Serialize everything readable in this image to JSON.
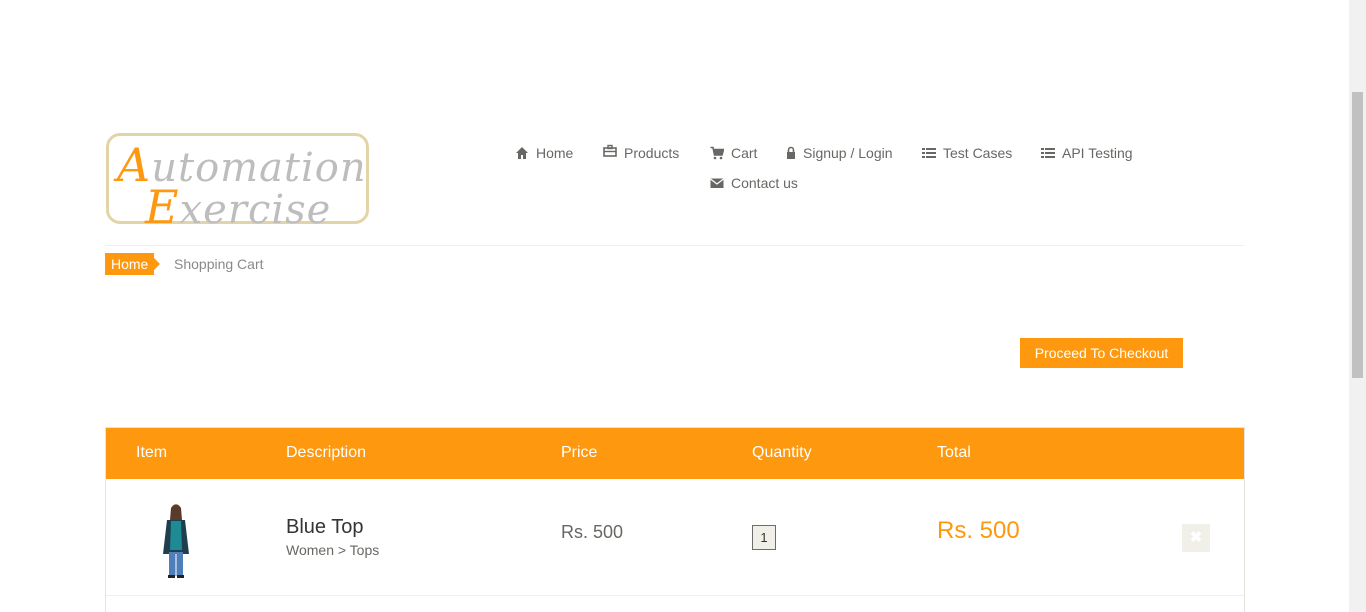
{
  "logo": {
    "line1_cap": "A",
    "line1_rest": "utomation",
    "line2_cap": "E",
    "line2_rest": "xercise"
  },
  "nav": {
    "home": "Home",
    "products": "Products",
    "cart": "Cart",
    "signup": "Signup / Login",
    "test_cases": "Test Cases",
    "api_testing": "API Testing",
    "contact": "Contact us"
  },
  "breadcrumb": {
    "home": "Home",
    "current": "Shopping Cart"
  },
  "checkout": {
    "label": "Proceed To Checkout"
  },
  "cart": {
    "headers": {
      "item": "Item",
      "description": "Description",
      "price": "Price",
      "quantity": "Quantity",
      "total": "Total"
    },
    "rows": [
      {
        "name": "Blue Top",
        "category": "Women > Tops",
        "price": "Rs. 500",
        "quantity": "1",
        "total": "Rs. 500",
        "delete": "✖"
      }
    ]
  },
  "colors": {
    "accent": "#fe980f",
    "text": "#696763",
    "dark_text": "#363432"
  },
  "icons": [
    "home-icon",
    "products-icon",
    "cart-icon",
    "lock-icon",
    "list-icon",
    "envelope-icon",
    "delete-icon"
  ]
}
